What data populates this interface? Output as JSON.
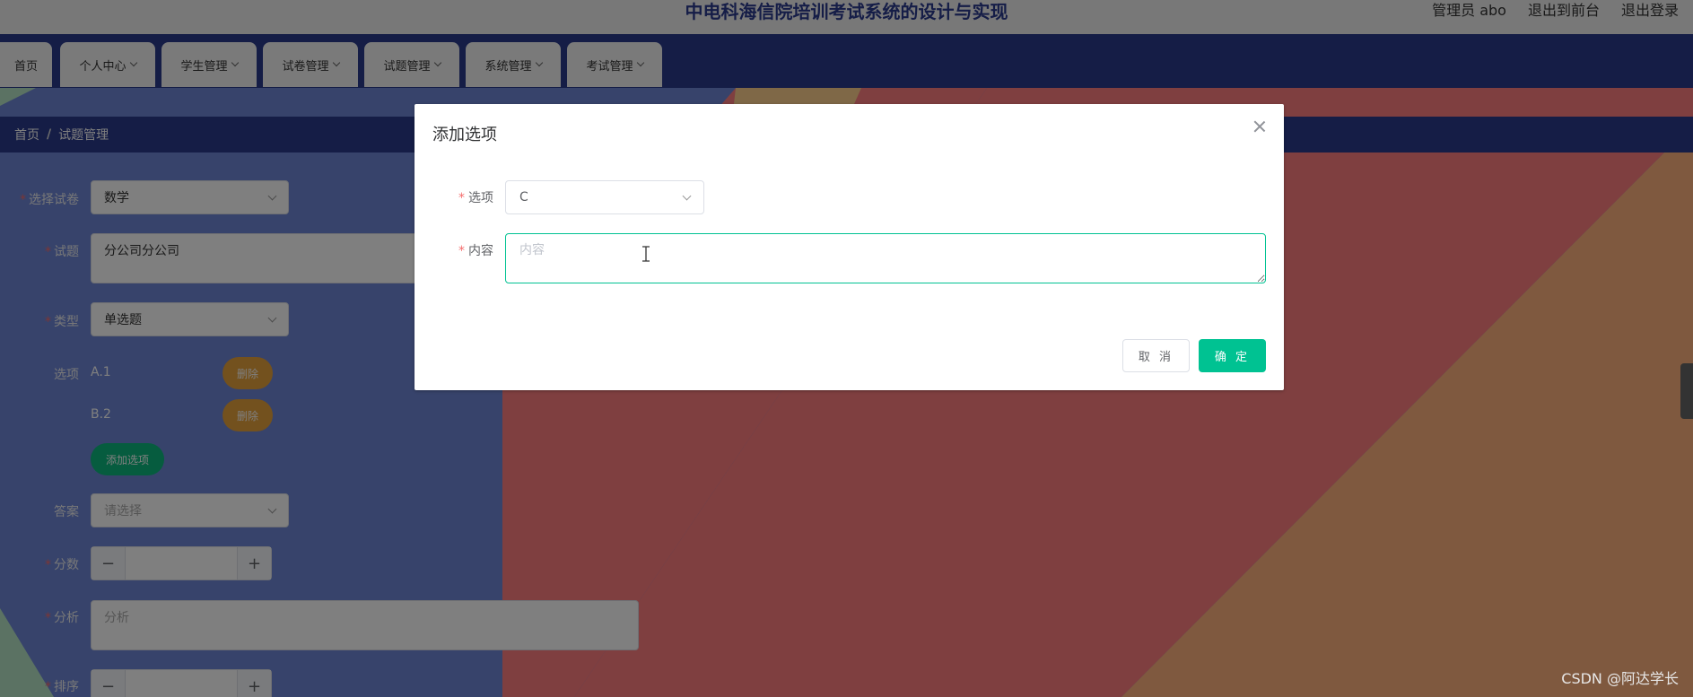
{
  "header": {
    "title": "中电科海信院培训考试系统的设计与实现",
    "user": "管理员 abo",
    "back_to_front": "退出到前台",
    "logout": "退出登录"
  },
  "nav": {
    "items": [
      {
        "label": "首页",
        "has_dropdown": false
      },
      {
        "label": "个人中心",
        "has_dropdown": true
      },
      {
        "label": "学生管理",
        "has_dropdown": true
      },
      {
        "label": "试卷管理",
        "has_dropdown": true
      },
      {
        "label": "试题管理",
        "has_dropdown": true
      },
      {
        "label": "系统管理",
        "has_dropdown": true
      },
      {
        "label": "考试管理",
        "has_dropdown": true
      }
    ]
  },
  "breadcrumb": {
    "home": "首页",
    "separator": "/",
    "current": "试题管理"
  },
  "form": {
    "paper_label": "选择试卷",
    "paper_value": "数学",
    "question_label": "试题",
    "question_value": "分公司分公司",
    "type_label": "类型",
    "type_value": "单选题",
    "options_label": "选项",
    "options": [
      {
        "text": "A.1",
        "delete_label": "删除"
      },
      {
        "text": "B.2",
        "delete_label": "删除"
      }
    ],
    "add_option_label": "添加选项",
    "answer_label": "答案",
    "answer_placeholder": "请选择",
    "score_label": "分数",
    "analysis_label": "分析",
    "analysis_placeholder": "分析",
    "sort_label": "排序",
    "minus": "−",
    "plus": "+"
  },
  "dialog": {
    "title": "添加选项",
    "option_label": "选项",
    "option_value": "C",
    "content_label": "内容",
    "content_placeholder": "内容",
    "cancel_label": "取 消",
    "confirm_label": "确 定"
  },
  "watermark": "CSDN @阿达学长",
  "colors": {
    "primary": "#00c292",
    "nav_bg": "#2a3a8c",
    "required": "#f56c6c",
    "delete_button": "#e6a23c",
    "add_button": "#0db97e"
  }
}
